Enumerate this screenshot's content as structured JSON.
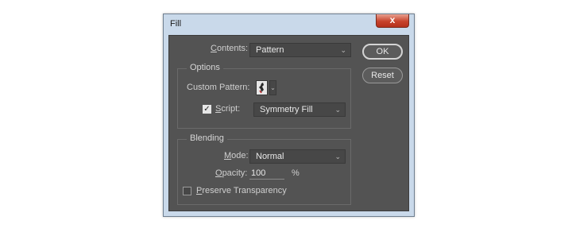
{
  "window": {
    "title": "Fill",
    "close_glyph": "x"
  },
  "contents": {
    "label_u": "C",
    "label_rest": "ontents:",
    "value": "Pattern"
  },
  "options": {
    "group_label": "Options",
    "custom_pattern_label": "Custom Pattern:",
    "script_checked": true,
    "script_label_u": "S",
    "script_label_rest": "cript:",
    "script_value": "Symmetry Fill"
  },
  "blending": {
    "group_label": "Blending",
    "mode_label_u": "M",
    "mode_label_rest": "ode:",
    "mode_value": "Normal",
    "opacity_label_u": "O",
    "opacity_label_rest": "pacity:",
    "opacity_value": "100",
    "opacity_unit": "%",
    "preserve_checked": false,
    "preserve_label_u": "P",
    "preserve_label_rest": "reserve Transparency"
  },
  "buttons": {
    "ok": "OK",
    "reset": "Reset"
  },
  "icons": {
    "chevron": "chevron-down-icon",
    "check": "check-icon",
    "pattern": "pattern-thumbnail"
  },
  "colors": {
    "panel": "#535353",
    "titlebar": "#c9d9ea",
    "close": "#c7432c"
  }
}
